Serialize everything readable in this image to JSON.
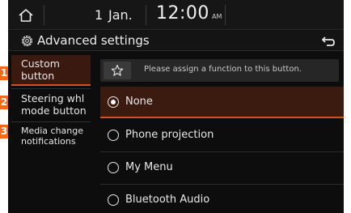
{
  "status": {
    "date_day": "1",
    "date_month": "Jan.",
    "time": "12:00",
    "ampm": "AM"
  },
  "title": {
    "text": "Advanced settings"
  },
  "left_menu": {
    "items": [
      {
        "marker": "1",
        "line1": "Custom",
        "line2": "button"
      },
      {
        "marker": "2",
        "line1": "Steering whl",
        "line2": "mode button"
      },
      {
        "marker": "3",
        "line1": "Media change",
        "line2": "notifications"
      }
    ]
  },
  "content": {
    "hint": "Please assign a function to this button.",
    "options": [
      {
        "label": "None"
      },
      {
        "label": "Phone projection"
      },
      {
        "label": "My Menu"
      },
      {
        "label": "Bluetooth Audio"
      }
    ],
    "selected_index": 0
  },
  "colors": {
    "accent": "#d2521f",
    "marker": "#f26b1d",
    "selected_bg": "#3b1a10",
    "background": "#0d0d0d"
  },
  "icons": [
    "home-icon",
    "gear-icon",
    "back-arrow-icon",
    "star-icon"
  ]
}
